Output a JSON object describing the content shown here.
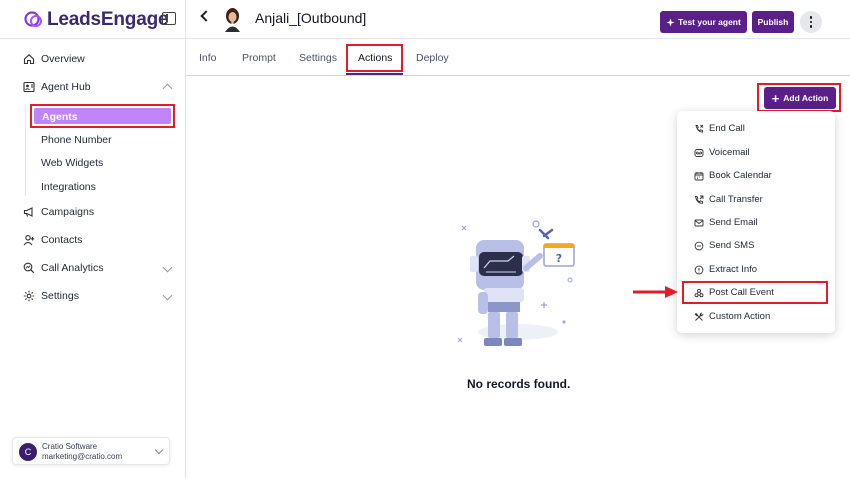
{
  "brand": {
    "name": "LeadsEngage"
  },
  "sidebar": {
    "items": [
      {
        "label": "Overview"
      },
      {
        "label": "Agent Hub"
      },
      {
        "label": "Campaigns"
      },
      {
        "label": "Contacts"
      },
      {
        "label": "Call Analytics"
      },
      {
        "label": "Settings"
      }
    ],
    "sub_items": [
      {
        "label": "Agents"
      },
      {
        "label": "Phone Number"
      },
      {
        "label": "Web Widgets"
      },
      {
        "label": "Integrations"
      }
    ],
    "account": {
      "initial": "C",
      "name": "Cratio Software",
      "email": "marketing@cratio.com"
    }
  },
  "header": {
    "agent_name": "Anjali_[Outbound]",
    "test_label": "Test your agent",
    "publish_label": "Publish"
  },
  "tabs": [
    {
      "label": "Info"
    },
    {
      "label": "Prompt"
    },
    {
      "label": "Settings"
    },
    {
      "label": "Actions"
    },
    {
      "label": "Deploy"
    }
  ],
  "actions": {
    "add_label": "Add Action",
    "menu": [
      {
        "label": "End Call",
        "icon": "end-call-icon"
      },
      {
        "label": "Voicemail",
        "icon": "voicemail-icon"
      },
      {
        "label": "Book Calendar",
        "icon": "calendar-icon"
      },
      {
        "label": "Call Transfer",
        "icon": "phone-transfer-icon"
      },
      {
        "label": "Send Email",
        "icon": "mail-icon"
      },
      {
        "label": "Send SMS",
        "icon": "sms-icon"
      },
      {
        "label": "Extract Info",
        "icon": "info-icon"
      },
      {
        "label": "Post Call Event",
        "icon": "webhook-icon"
      },
      {
        "label": "Custom Action",
        "icon": "tools-icon"
      }
    ]
  },
  "empty_state": {
    "message": "No records found."
  },
  "colors": {
    "accent": "#5b1f8a",
    "highlight": "#e11d2b",
    "agents_bg": "#c084fc"
  }
}
